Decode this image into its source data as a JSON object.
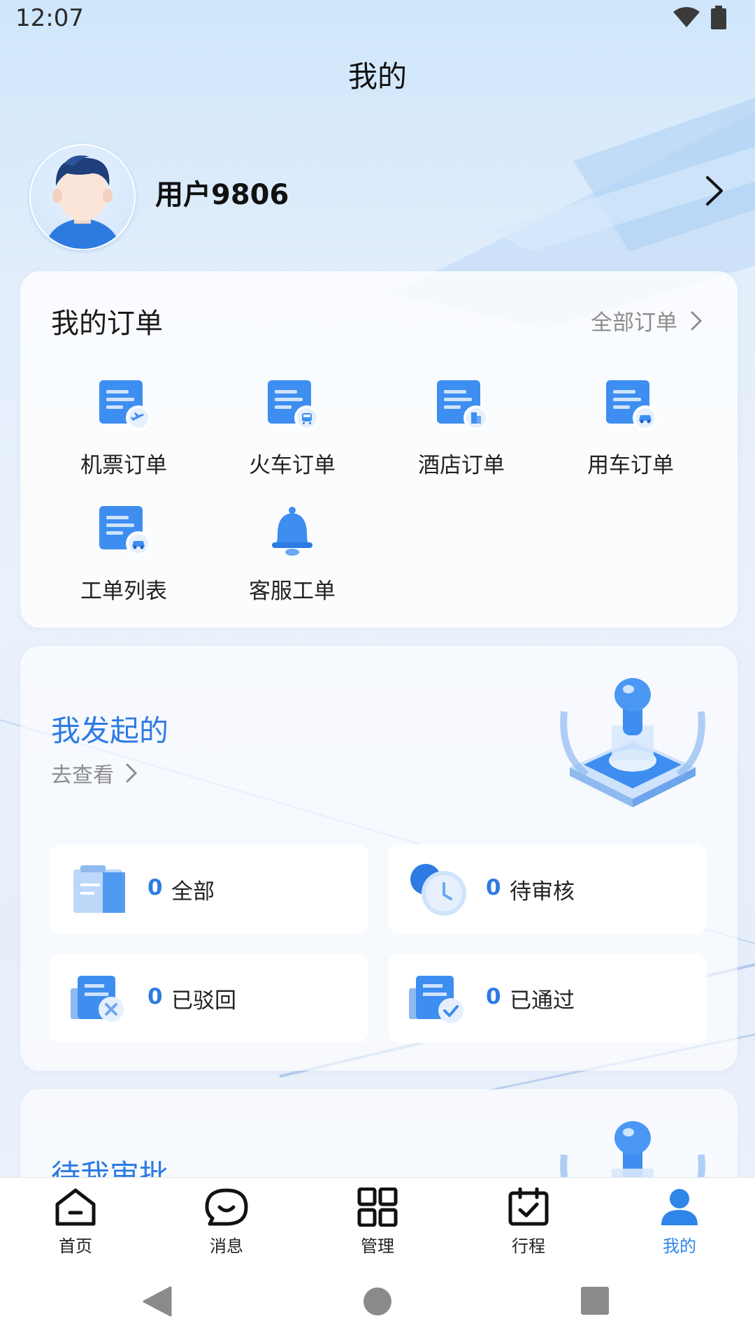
{
  "status_bar": {
    "time": "12:07",
    "wifi_icon": "wifi-icon",
    "battery_icon": "battery-icon"
  },
  "header": {
    "title": "我的"
  },
  "user": {
    "name": "用户9806",
    "avatar_icon": "user-avatar",
    "chevron_icon": "chevron-right-icon"
  },
  "orders": {
    "title": "我的订单",
    "all_link": "全部订单",
    "items": [
      {
        "label": "机票订单",
        "icon": "flight-order-icon"
      },
      {
        "label": "火车订单",
        "icon": "train-order-icon"
      },
      {
        "label": "酒店订单",
        "icon": "hotel-order-icon"
      },
      {
        "label": "用车订单",
        "icon": "car-order-icon"
      },
      {
        "label": "工单列表",
        "icon": "work-order-list-icon"
      },
      {
        "label": "客服工单",
        "icon": "bell-icon"
      }
    ]
  },
  "initiated": {
    "title": "我发起的",
    "link": "去查看",
    "stats": [
      {
        "count": "0",
        "label": "全部",
        "icon": "clipboard-icon"
      },
      {
        "count": "0",
        "label": "待审核",
        "icon": "clock-icon"
      },
      {
        "count": "0",
        "label": "已驳回",
        "icon": "rejected-doc-icon"
      },
      {
        "count": "0",
        "label": "已通过",
        "icon": "approved-doc-icon"
      }
    ]
  },
  "pending_approval": {
    "title": "待我审批"
  },
  "tabs": [
    {
      "label": "首页",
      "icon": "home-icon",
      "active": false
    },
    {
      "label": "消息",
      "icon": "message-icon",
      "active": false
    },
    {
      "label": "管理",
      "icon": "grid-icon",
      "active": false
    },
    {
      "label": "行程",
      "icon": "calendar-icon",
      "active": false
    },
    {
      "label": "我的",
      "icon": "person-icon",
      "active": true
    }
  ],
  "colors": {
    "accent": "#2f86e8",
    "title_blue": "#2d7be3",
    "icon_blue": "#3d8ef0"
  }
}
